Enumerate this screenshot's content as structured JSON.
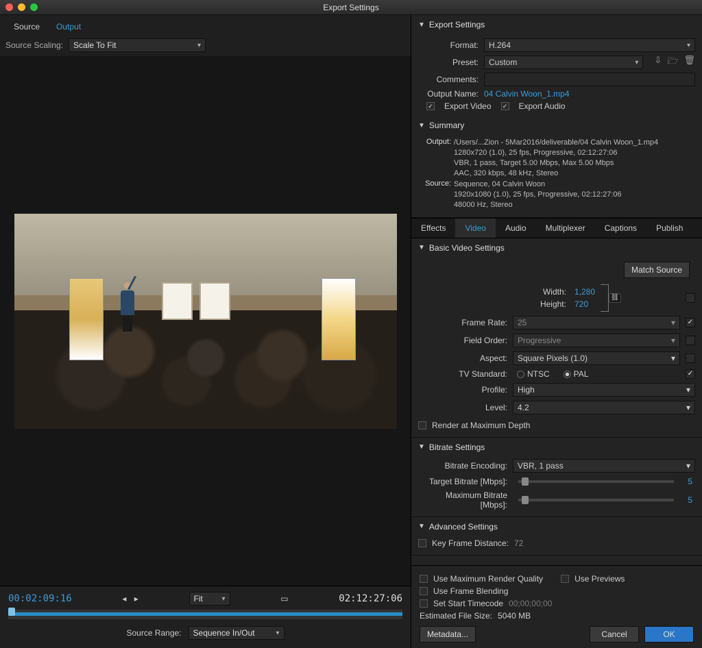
{
  "window": {
    "title": "Export Settings"
  },
  "leftTabs": {
    "source": "Source",
    "output": "Output"
  },
  "sourceScaling": {
    "label": "Source Scaling:",
    "value": "Scale To Fit"
  },
  "timecode": {
    "left": "00:02:09:16",
    "right": "02:12:27:06",
    "fit": "Fit"
  },
  "sourceRange": {
    "label": "Source Range:",
    "value": "Sequence In/Out"
  },
  "exportSettings": {
    "heading": "Export Settings",
    "formatLabel": "Format:",
    "format": "H.264",
    "presetLabel": "Preset:",
    "preset": "Custom",
    "commentsLabel": "Comments:",
    "outputNameLabel": "Output Name:",
    "outputName": "04 Calvin Woon_1.mp4",
    "exportVideo": "Export Video",
    "exportAudio": "Export Audio"
  },
  "summary": {
    "heading": "Summary",
    "outputLabel": "Output:",
    "outputLines": "/Users/...Zion - 5Mar2016/deliverable/04 Calvin Woon_1.mp4\n1280x720 (1.0), 25 fps, Progressive, 02:12:27:06\nVBR, 1 pass, Target 5.00 Mbps, Max 5.00 Mbps\nAAC, 320 kbps, 48 kHz, Stereo",
    "sourceLabel": "Source:",
    "sourceLines": "Sequence, 04 Calvin Woon\n1920x1080 (1.0), 25 fps, Progressive, 02:12:27:06\n48000 Hz, Stereo"
  },
  "rightTabs": {
    "effects": "Effects",
    "video": "Video",
    "audio": "Audio",
    "mux": "Multiplexer",
    "captions": "Captions",
    "publish": "Publish"
  },
  "basicVideo": {
    "heading": "Basic Video Settings",
    "matchSource": "Match Source",
    "widthLabel": "Width:",
    "width": "1,280",
    "heightLabel": "Height:",
    "height": "720",
    "frameRateLabel": "Frame Rate:",
    "frameRate": "25",
    "fieldOrderLabel": "Field Order:",
    "fieldOrder": "Progressive",
    "aspectLabel": "Aspect:",
    "aspect": "Square Pixels (1.0)",
    "tvStdLabel": "TV Standard:",
    "ntsc": "NTSC",
    "pal": "PAL",
    "profileLabel": "Profile:",
    "profile": "High",
    "levelLabel": "Level:",
    "level": "4.2",
    "renderMaxDepth": "Render at Maximum Depth"
  },
  "bitrate": {
    "heading": "Bitrate Settings",
    "encodingLabel": "Bitrate Encoding:",
    "encoding": "VBR, 1 pass",
    "targetLabel": "Target Bitrate [Mbps]:",
    "target": "5",
    "maxLabel": "Maximum Bitrate [Mbps]:",
    "max": "5"
  },
  "advanced": {
    "heading": "Advanced Settings",
    "keyframeLabel": "Key Frame Distance:",
    "keyframe": "72"
  },
  "footer": {
    "maxQuality": "Use Maximum Render Quality",
    "previews": "Use Previews",
    "frameBlending": "Use Frame Blending",
    "setStartTC": "Set Start Timecode",
    "startTC": "00;00;00;00",
    "estLabel": "Estimated File Size:",
    "estSize": "5040 MB",
    "metadata": "Metadata...",
    "cancel": "Cancel",
    "ok": "OK"
  }
}
